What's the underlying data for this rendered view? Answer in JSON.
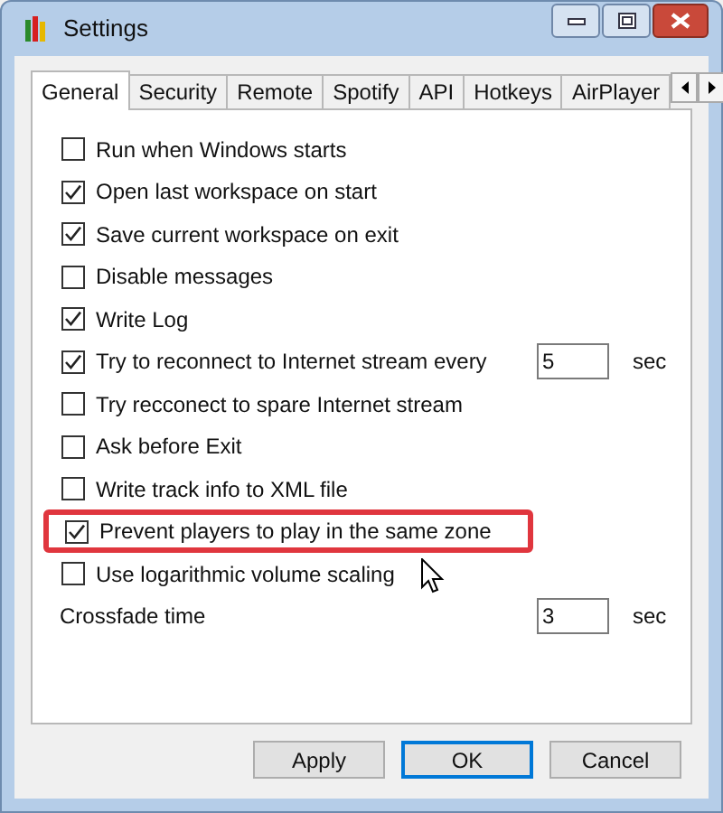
{
  "window": {
    "title": "Settings"
  },
  "tabs": [
    {
      "label": "General",
      "selected": true
    },
    {
      "label": "Security",
      "selected": false
    },
    {
      "label": "Remote",
      "selected": false
    },
    {
      "label": "Spotify",
      "selected": false
    },
    {
      "label": "API",
      "selected": false
    },
    {
      "label": "Hotkeys",
      "selected": false
    },
    {
      "label": "AirPlayer",
      "selected": false
    }
  ],
  "options": [
    {
      "kind": "checkbox",
      "label": "Run when Windows starts",
      "checked": false,
      "highlighted": false
    },
    {
      "kind": "checkbox",
      "label": "Open last workspace on start",
      "checked": true,
      "highlighted": false
    },
    {
      "kind": "checkbox",
      "label": "Save current workspace on exit",
      "checked": true,
      "highlighted": false
    },
    {
      "kind": "checkbox",
      "label": "Disable messages",
      "checked": false,
      "highlighted": false
    },
    {
      "kind": "checkbox",
      "label": "Write Log",
      "checked": true,
      "highlighted": false
    },
    {
      "kind": "checkbox-field",
      "label": "Try to reconnect to Internet stream every",
      "checked": true,
      "highlighted": false,
      "value": "5",
      "unit": "sec"
    },
    {
      "kind": "checkbox",
      "label": "Try recconect to spare Internet stream",
      "checked": false,
      "highlighted": false
    },
    {
      "kind": "checkbox",
      "label": "Ask before Exit",
      "checked": false,
      "highlighted": false
    },
    {
      "kind": "checkbox",
      "label": "Write track info to XML file",
      "checked": false,
      "highlighted": false
    },
    {
      "kind": "checkbox",
      "label": "Prevent players to play in the same zone",
      "checked": true,
      "highlighted": true
    },
    {
      "kind": "checkbox",
      "label": "Use logarithmic volume scaling",
      "checked": false,
      "highlighted": false
    },
    {
      "kind": "field",
      "label": "Crossfade time",
      "value": "3",
      "unit": "sec"
    }
  ],
  "buttons": [
    {
      "label": "Apply",
      "default": false
    },
    {
      "label": "OK",
      "default": true
    },
    {
      "label": "Cancel",
      "default": false
    }
  ]
}
